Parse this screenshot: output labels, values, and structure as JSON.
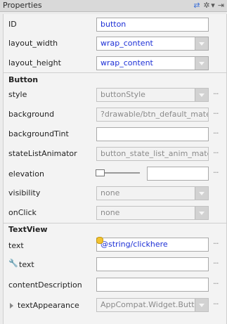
{
  "header": {
    "title": "Properties",
    "icons": [
      "swap-icon",
      "gear-icon",
      "chevron-down-icon",
      "pin-icon"
    ],
    "swap_glyph": "⇄",
    "gear_glyph": "✲",
    "chevron_glyph": "▾",
    "pin_glyph": "⇥"
  },
  "general": {
    "id": {
      "label": "ID",
      "value": "button"
    },
    "layout_width": {
      "label": "layout_width",
      "value": "wrap_content"
    },
    "layout_height": {
      "label": "layout_height",
      "value": "wrap_content"
    }
  },
  "button_section": {
    "title": "Button",
    "style": {
      "label": "style",
      "value": "buttonStyle"
    },
    "background": {
      "label": "background",
      "value": "?drawable/btn_default_mate"
    },
    "backgroundTint": {
      "label": "backgroundTint",
      "value": ""
    },
    "stateListAnimator": {
      "label": "stateListAnimator",
      "value": "button_state_list_anim_mate"
    },
    "elevation": {
      "label": "elevation",
      "value": ""
    },
    "visibility": {
      "label": "visibility",
      "value": "none"
    },
    "onClick": {
      "label": "onClick",
      "value": "none"
    }
  },
  "textview_section": {
    "title": "TextView",
    "text": {
      "label": "text",
      "value": "@string/clickhere"
    },
    "text_tools": {
      "label": "text",
      "value": ""
    },
    "contentDescription": {
      "label": "contentDescription",
      "value": ""
    },
    "textAppearance": {
      "label": "textAppearance",
      "value": "AppCompat.Widget.Button"
    }
  },
  "ellipsis": "···",
  "wrench_glyph": "🔧",
  "colors": {
    "value_blue": "#1c2fd6",
    "accent": "#3a6fd8"
  }
}
